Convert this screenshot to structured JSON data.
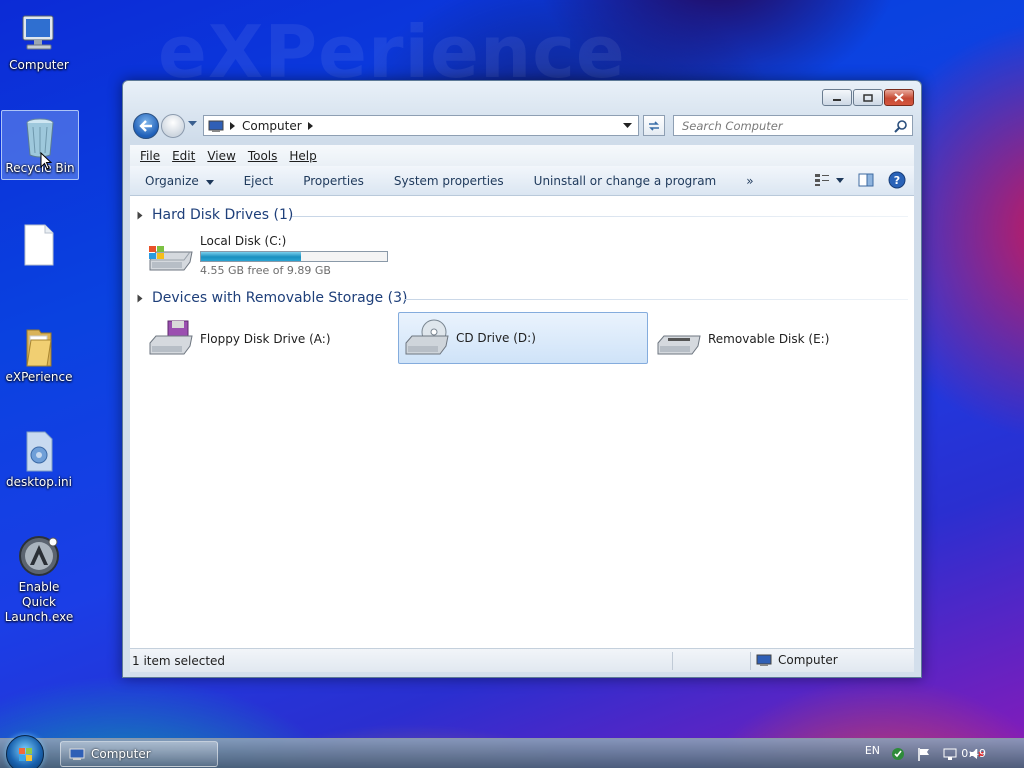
{
  "wallpaper": {
    "brand_text": "eXPerience"
  },
  "desktop": {
    "icons": [
      {
        "label": "Computer"
      },
      {
        "label": "Recycle Bin"
      },
      {
        "label": ""
      },
      {
        "label": "eXPerience"
      },
      {
        "label": "desktop.ini"
      },
      {
        "label": "Enable Quick Launch.exe"
      }
    ]
  },
  "window": {
    "address": {
      "path": "Computer"
    },
    "search": {
      "placeholder": "Search Computer"
    },
    "menu": {
      "file": "File",
      "edit": "Edit",
      "view": "View",
      "tools": "Tools",
      "help": "Help"
    },
    "commands": {
      "organize": "Organize",
      "eject": "Eject",
      "properties": "Properties",
      "system_properties": "System properties",
      "uninstall": "Uninstall or change a program",
      "more": "»"
    },
    "groups": [
      {
        "title": "Hard Disk Drives (1)"
      },
      {
        "title": "Devices with Removable Storage (3)"
      }
    ],
    "drives": {
      "local_c": {
        "label": "Local Disk (C:)",
        "free_text": "4.55 GB free of 9.89 GB",
        "used_fraction": 0.54
      },
      "floppy_a": {
        "label": "Floppy Disk Drive (A:)"
      },
      "cd_d": {
        "label": "CD Drive (D:)"
      },
      "removable_e": {
        "label": "Removable Disk (E:)"
      }
    },
    "status": {
      "selection": "1 item selected",
      "location": "Computer"
    }
  },
  "taskbar": {
    "window_button": "Computer",
    "language": "EN",
    "clock": "0:49"
  },
  "colors": {
    "selection": "#cfe3f8",
    "capacity_fill": "#1a8fbf",
    "group_title": "#1e3f7a"
  }
}
